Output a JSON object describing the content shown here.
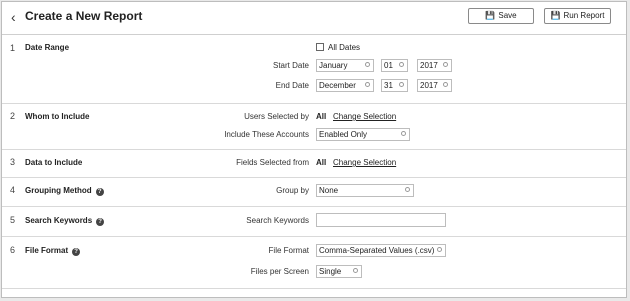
{
  "header": {
    "title": "Create a New Report",
    "save_label": "Save",
    "run_label": "Run Report"
  },
  "sections": {
    "date_range": {
      "number": "1",
      "title": "Date Range",
      "all_dates_label": "All Dates",
      "start_label": "Start Date",
      "start_month": "January",
      "start_day": "01",
      "start_year": "2017",
      "end_label": "End Date",
      "end_month": "December",
      "end_day": "31",
      "end_year": "2017"
    },
    "whom": {
      "number": "2",
      "title": "Whom to Include",
      "users_label": "Users Selected by",
      "users_value": "All",
      "change_link": "Change Selection",
      "accounts_label": "Include These Accounts",
      "accounts_value": "Enabled Only"
    },
    "data": {
      "number": "3",
      "title": "Data to Include",
      "fields_label": "Fields Selected from",
      "fields_value": "All",
      "change_link": "Change Selection"
    },
    "grouping": {
      "number": "4",
      "title": "Grouping Method",
      "group_label": "Group by",
      "group_value": "None"
    },
    "keywords": {
      "number": "5",
      "title": "Search Keywords",
      "search_label": "Search Keywords",
      "search_value": ""
    },
    "format": {
      "number": "6",
      "title": "File Format",
      "format_label": "File Format",
      "format_value": "Comma-Separated Values (.csv)",
      "files_label": "Files per Screen",
      "files_value": "Single"
    }
  }
}
